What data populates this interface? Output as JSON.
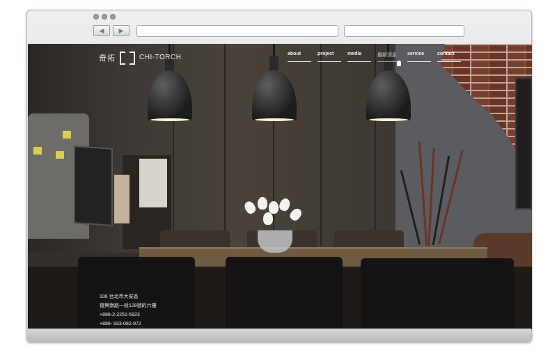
{
  "browser": {
    "back_icon": "◀",
    "forward_icon": "▶",
    "address_value": "",
    "search_value": ""
  },
  "site": {
    "logo_cn": "奇拓",
    "logo_en": "CHI-TORCH",
    "nav": [
      {
        "label": "about"
      },
      {
        "label": "project"
      },
      {
        "label": "media"
      },
      {
        "label": "最新消息"
      },
      {
        "label": "service"
      },
      {
        "label": "contact"
      }
    ],
    "hover_index": 3,
    "address_lines": [
      "106  台北市大安區",
      "復興南路一段128號的六樓",
      "+886-2-2251-5923",
      "+886- 933-082-972"
    ]
  },
  "colors": {
    "brand_text": "#f2f2f2",
    "nav_hover": "#9a9a9a",
    "scene_dark": "#332f2c"
  }
}
